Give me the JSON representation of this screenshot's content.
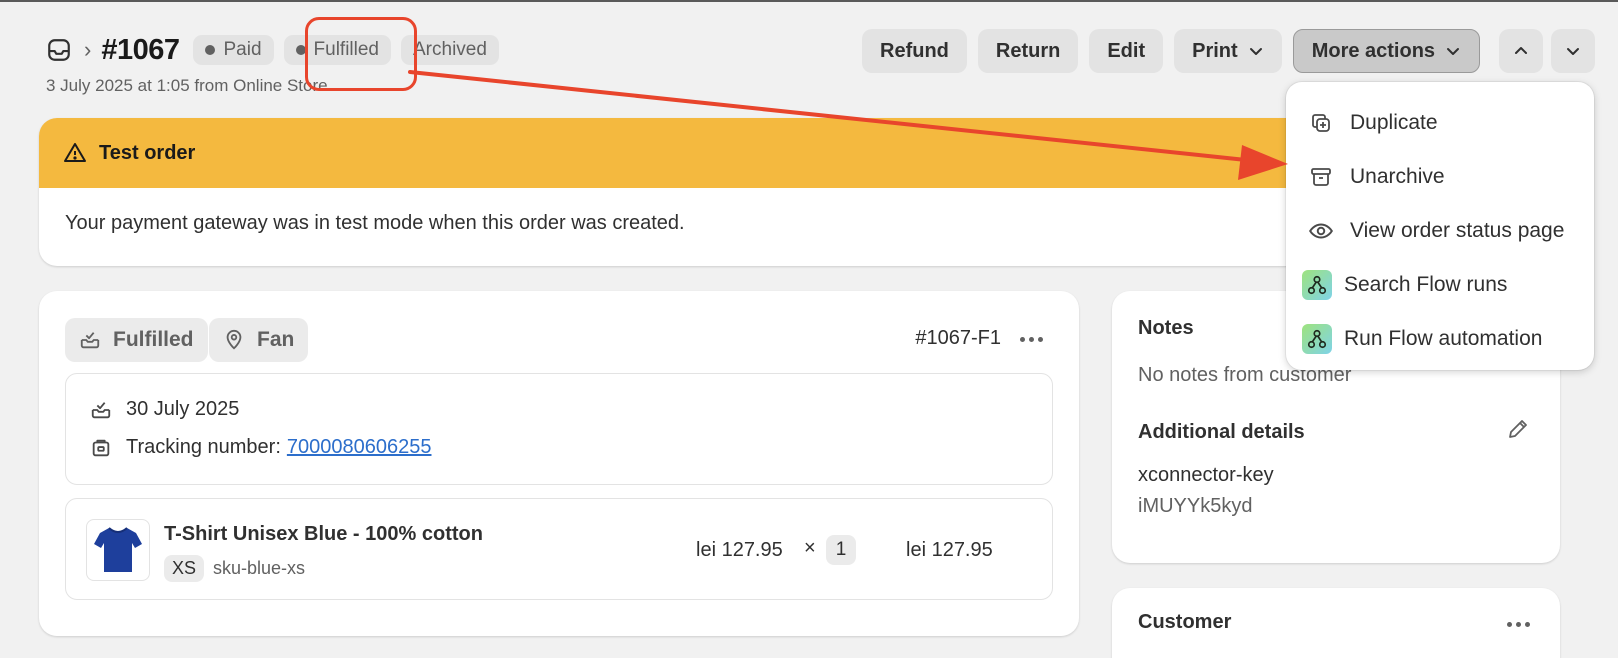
{
  "header": {
    "order_number": "#1067",
    "badges": [
      "Paid",
      "Fulfilled",
      "Archived"
    ],
    "subtitle": "3 July 2025 at 1:05 from Online Store"
  },
  "actions": {
    "refund": "Refund",
    "return": "Return",
    "edit": "Edit",
    "print": "Print",
    "more_actions": "More actions"
  },
  "menu": {
    "items": [
      {
        "label": "Duplicate",
        "icon": "duplicate-icon"
      },
      {
        "label": "Unarchive",
        "icon": "archive-box-icon"
      },
      {
        "label": "View order status page",
        "icon": "eye-icon"
      },
      {
        "label": "Search Flow runs",
        "icon": "flow-icon"
      },
      {
        "label": "Run Flow automation",
        "icon": "flow-icon"
      }
    ]
  },
  "banner": {
    "title": "Test order",
    "message": "Your payment gateway was in test mode when this order was created."
  },
  "fulfillment": {
    "status": "Fulfilled",
    "location": "Fan",
    "id": "#1067-F1",
    "date": "30 July 2025",
    "tracking_label": "Tracking number:",
    "tracking_number": "7000080606255",
    "product": {
      "title": "T-Shirt Unisex Blue - 100% cotton",
      "size": "XS",
      "sku": "sku-blue-xs",
      "unit_price": "lei 127.95",
      "times": "×",
      "quantity": "1",
      "total": "lei 127.95"
    }
  },
  "notes": {
    "title": "Notes",
    "empty": "No notes from customer",
    "additional_title": "Additional details",
    "key": "xconnector-key",
    "value": "iMUYYk5kyd"
  },
  "customer": {
    "title": "Customer"
  },
  "colors": {
    "banner_warning": "#f4b93f",
    "annotation": "#e8452c",
    "link": "#2c6ecb"
  }
}
